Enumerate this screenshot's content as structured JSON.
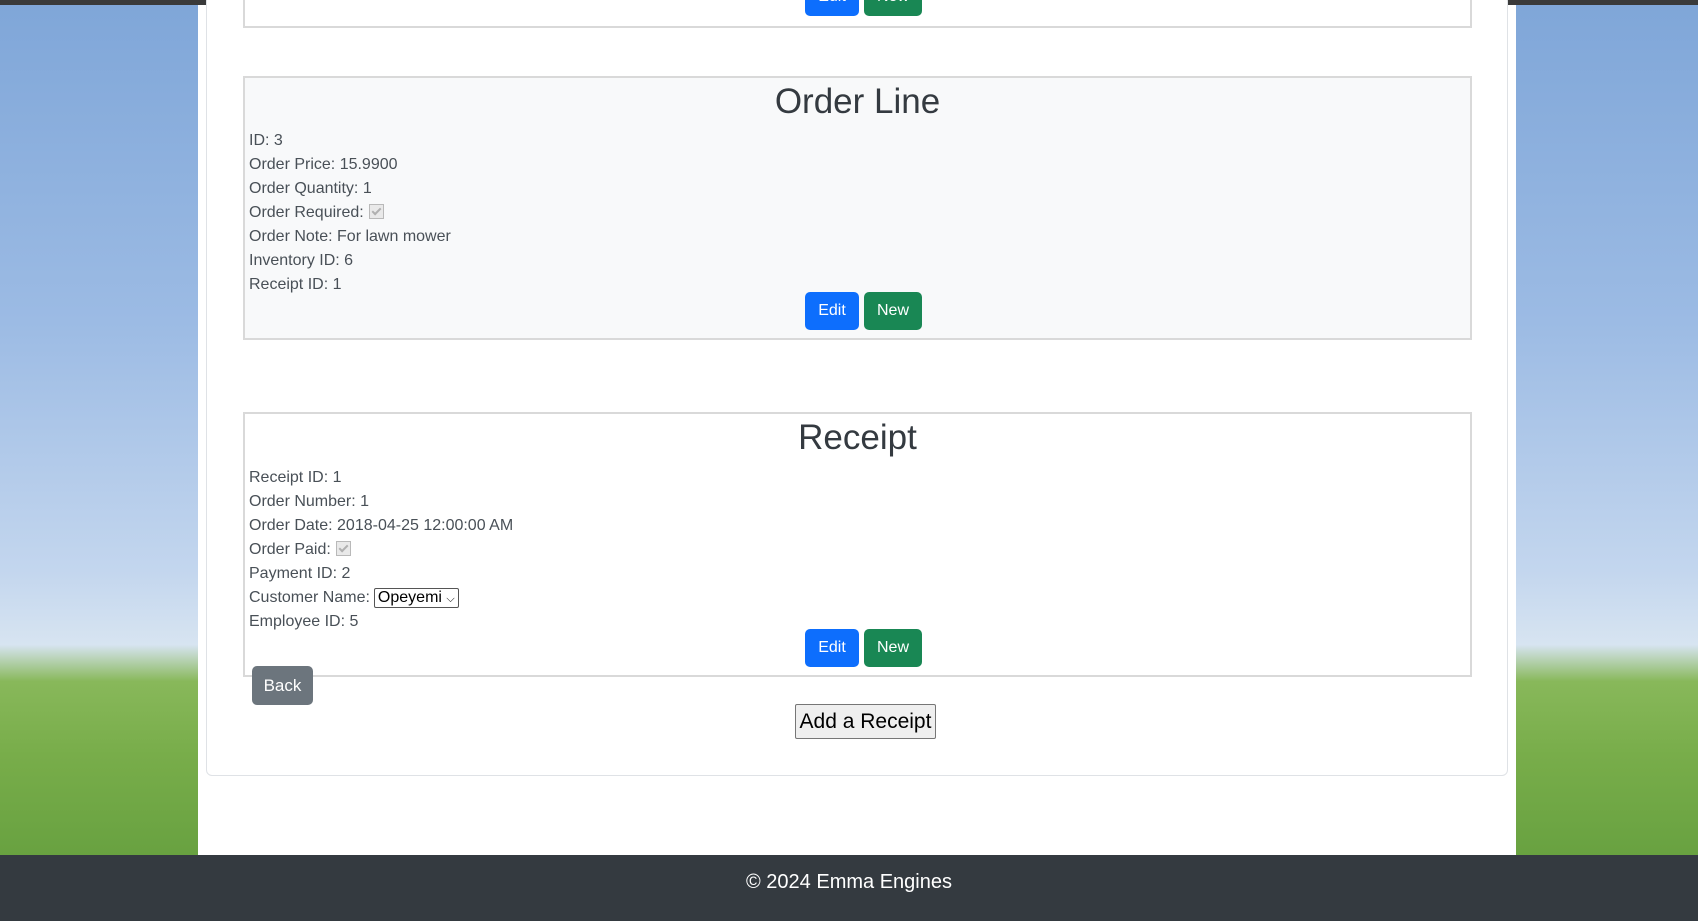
{
  "top_record": {
    "edit_label": "Edit",
    "new_label": "New"
  },
  "order_line": {
    "title": "Order Line",
    "id": "ID: 3",
    "order_price": "Order Price: 15.9900",
    "order_quantity": "Order Quantity: 1",
    "order_required_label": "Order Required:",
    "order_required_checked": true,
    "order_note": "Order Note: For lawn mower",
    "inventory_id": "Inventory ID: 6",
    "receipt_id": "Receipt ID: 1",
    "edit_label": "Edit",
    "new_label": "New"
  },
  "receipt": {
    "title": "Receipt",
    "receipt_id": "Receipt ID: 1",
    "order_number": "Order Number: 1",
    "order_date": "Order Date: 2018-04-25 12:00:00 AM",
    "order_paid_label": "Order Paid:",
    "order_paid_checked": true,
    "payment_id": "Payment ID: 2",
    "customer_name_label": "Customer Name:",
    "customer_name_selected": "Opeyemi",
    "employee_id": "Employee ID: 5",
    "edit_label": "Edit",
    "new_label": "New"
  },
  "actions": {
    "back_label": "Back",
    "add_receipt_label": "Add a Receipt"
  },
  "footer": {
    "text": "© 2024 Emma Engines"
  },
  "colors": {
    "edit_button": "#0d6efd",
    "new_button": "#198754",
    "back_button": "#6c757d",
    "footer_bg": "#343a40"
  }
}
